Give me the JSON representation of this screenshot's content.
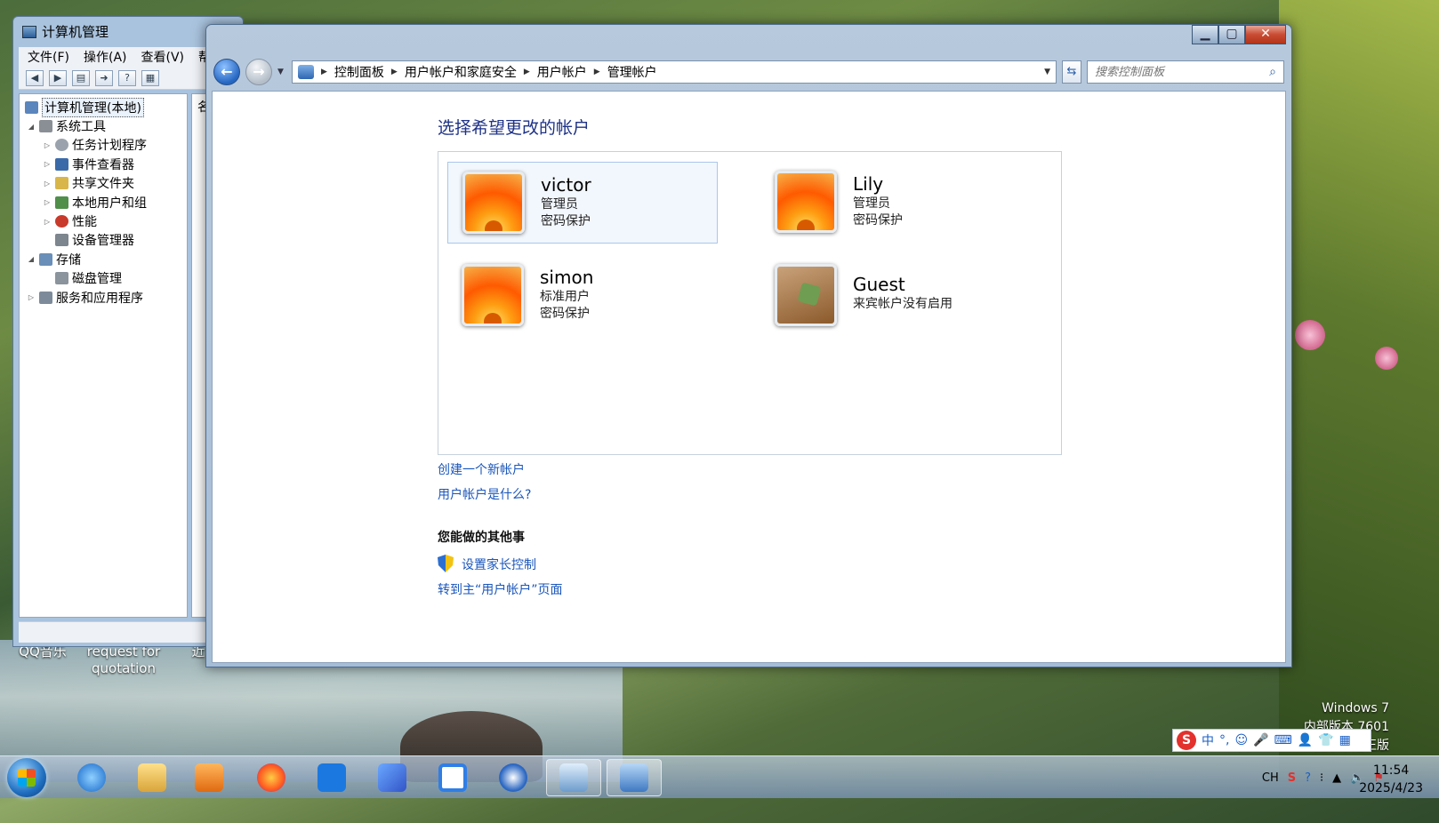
{
  "desktop": {
    "icons": [
      {
        "label": "QQ音乐"
      },
      {
        "label": "request for quotation"
      },
      {
        "label": "近"
      }
    ],
    "watermark": [
      "Windows 7",
      "内部版本 7601",
      "此 Windows 副本不是正版"
    ]
  },
  "computer_management": {
    "title": "计算机管理",
    "menu": [
      "文件(F)",
      "操作(A)",
      "查看(V)",
      "帮"
    ],
    "tree": [
      {
        "label": "计算机管理(本地)",
        "level": 0
      },
      {
        "label": "系统工具",
        "level": 1
      },
      {
        "label": "任务计划程序",
        "level": 2
      },
      {
        "label": "事件查看器",
        "level": 2
      },
      {
        "label": "共享文件夹",
        "level": 2
      },
      {
        "label": "本地用户和组",
        "level": 2
      },
      {
        "label": "性能",
        "level": 2
      },
      {
        "label": "设备管理器",
        "level": 2
      },
      {
        "label": "存储",
        "level": 1
      },
      {
        "label": "磁盘管理",
        "level": 2
      },
      {
        "label": "服务和应用程序",
        "level": 1
      }
    ],
    "right_header": "名"
  },
  "user_accounts": {
    "breadcrumb": [
      "控制面板",
      "用户帐户和家庭安全",
      "用户帐户",
      "管理帐户"
    ],
    "search_placeholder": "搜索控制面板",
    "page_title": "选择希望更改的帐户",
    "accounts": [
      {
        "name": "victor",
        "lines": [
          "管理员",
          "密码保护"
        ],
        "avatar": "flower"
      },
      {
        "name": "Lily",
        "lines": [
          "管理员",
          "密码保护"
        ],
        "avatar": "flower"
      },
      {
        "name": "simon",
        "lines": [
          "标准用户",
          "密码保护"
        ],
        "avatar": "flower"
      },
      {
        "name": "Guest",
        "lines": [
          "来宾帐户没有启用"
        ],
        "avatar": "suitcase"
      }
    ],
    "links": {
      "create": "创建一个新帐户",
      "what_is": "用户帐户是什么?",
      "other_heading": "您能做的其他事",
      "parental": "设置家长控制",
      "goto_main": "转到主“用户帐户”页面"
    }
  },
  "ime": {
    "mode": "中"
  },
  "taskbar": {
    "tray_lang": "CH",
    "time": "11:54",
    "date": "2025/4/23"
  }
}
